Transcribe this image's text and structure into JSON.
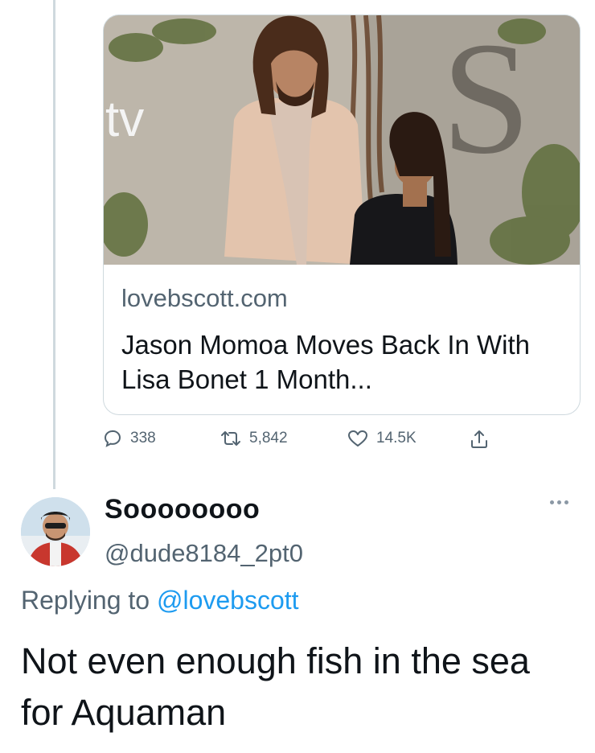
{
  "link_card": {
    "image_alt": "Jason Momoa in a pink suit standing next to Lisa Bonet at an event",
    "backdrop_logo_text": "tv",
    "backdrop_letter": "S",
    "domain": "lovebscott.com",
    "title": "Jason Momoa Moves Back In With Lisa Bonet 1 Month..."
  },
  "engagement": {
    "replies": "338",
    "retweets": "5,842",
    "likes": "14.5K",
    "icons": [
      "reply-icon",
      "retweet-icon",
      "like-icon",
      "share-icon"
    ]
  },
  "reply": {
    "display_name": "Soooooooo",
    "handle": "@dude8184_2pt0",
    "replying_prefix": "Replying to ",
    "replying_to": "@lovebscott",
    "text": "Not even enough fish in the sea for Aquaman"
  },
  "colors": {
    "mention": "#1d9bf0",
    "secondary_text": "#536471",
    "border": "#cfd9de"
  }
}
